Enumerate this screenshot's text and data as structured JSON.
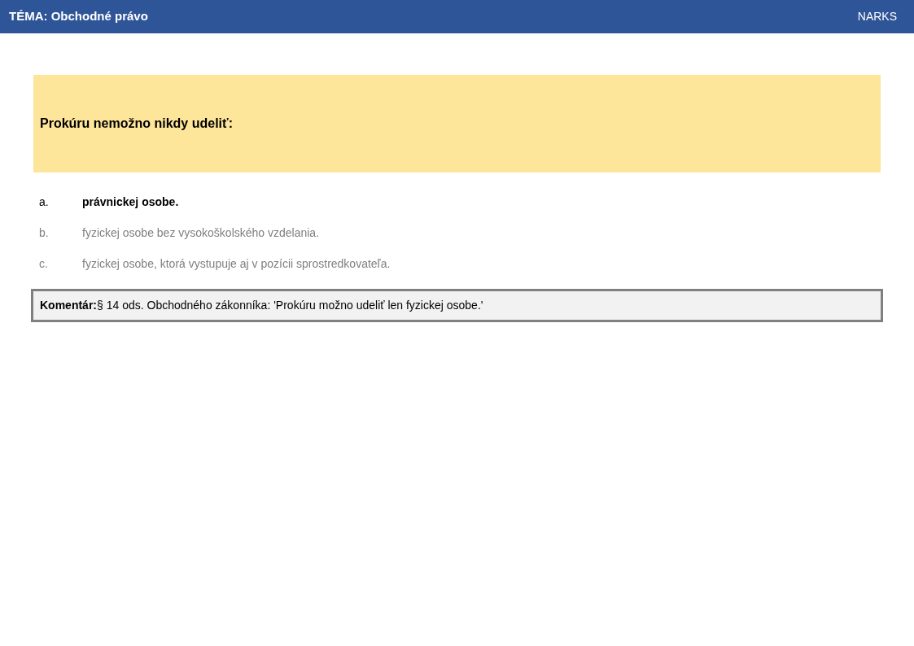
{
  "header": {
    "title": "TÉMA: Obchodné právo",
    "brand": "NARKS"
  },
  "question": "Prokúru nemožno nikdy udeliť:",
  "options": [
    {
      "letter": "a.",
      "text": "právnickej osobe.",
      "correct": true
    },
    {
      "letter": "b.",
      "text": "fyzickej osobe bez vysokoškolského vzdelania.",
      "correct": false
    },
    {
      "letter": "c.",
      "text": "fyzickej osobe, ktorá vystupuje aj v pozícii sprostredkovateľa.",
      "correct": false
    }
  ],
  "comment": "**Komentár:**§ 14 ods. Obchodného zákonníka: 'Prokúru možno udeliť len fyzickej osobe.'"
}
